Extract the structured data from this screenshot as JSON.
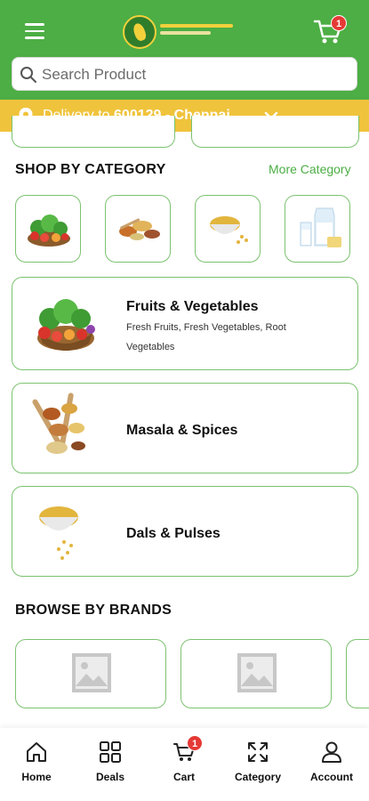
{
  "header": {
    "search_placeholder": "Search Product",
    "cart_badge": "1",
    "brand_color": "#4cae44",
    "menu_icon": "hamburger-icon",
    "logo": "store-logo"
  },
  "delivery": {
    "prefix": "Delivery to ",
    "pincode": "600129",
    "separator": " - ",
    "city": "Chennai",
    "bar_color": "#f0c33c"
  },
  "shop_by_category": {
    "title": "SHOP BY CATEGORY",
    "more_label": "More Category",
    "thumbnails": [
      "fruits-vegetables",
      "masala-spices",
      "dals-pulses",
      "dairy"
    ]
  },
  "categories": [
    {
      "title": "Fruits & Vegetables",
      "subtitle": "Fresh Fruits, Fresh Vegetables, Root Vegetables"
    },
    {
      "title": "Masala & Spices",
      "subtitle": ""
    },
    {
      "title": "Dals & Pulses",
      "subtitle": ""
    }
  ],
  "browse_by_brands": {
    "title": "BROWSE BY BRANDS"
  },
  "bottom_nav": [
    {
      "label": "Home",
      "icon": "home-icon"
    },
    {
      "label": "Deals",
      "icon": "grid-icon"
    },
    {
      "label": "Cart",
      "icon": "cart-icon",
      "badge": "1"
    },
    {
      "label": "Category",
      "icon": "expand-icon"
    },
    {
      "label": "Account",
      "icon": "user-icon"
    }
  ]
}
